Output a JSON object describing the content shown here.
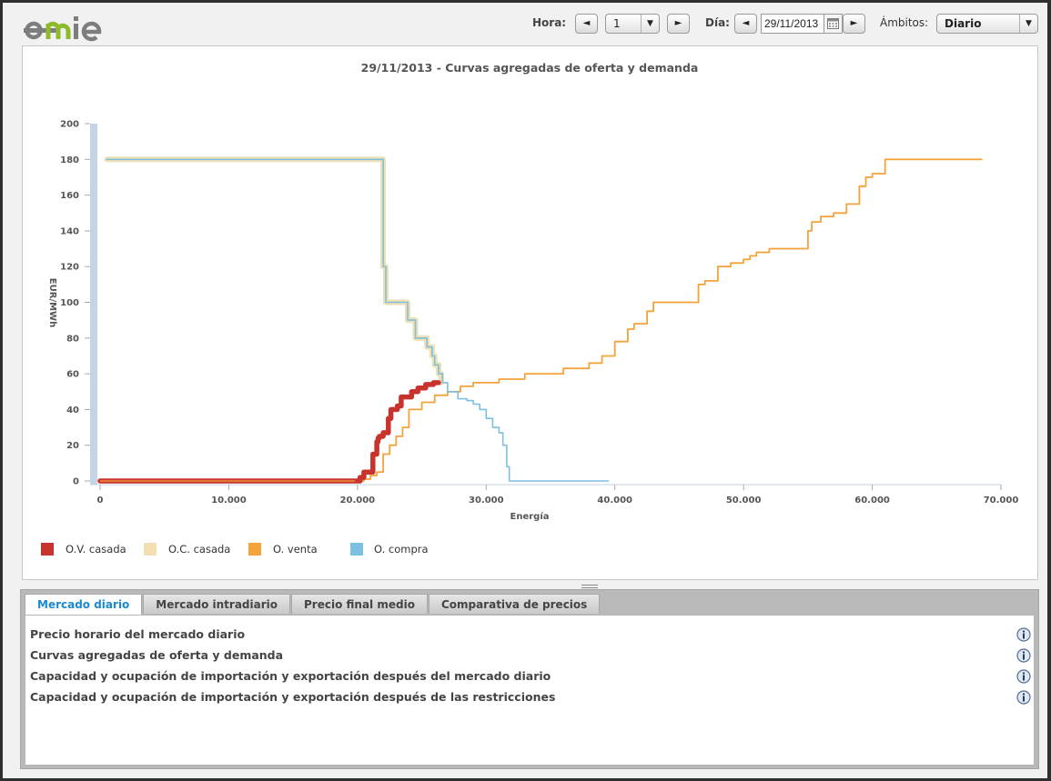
{
  "header": {
    "logo_text": "omie",
    "hora_label": "Hora:",
    "hora_value": "1",
    "dia_label": "Día:",
    "dia_value": "29/11/2013",
    "ambitos_label": "Ámbitos:",
    "ambitos_value": "Diario",
    "prev_glyph": "◄",
    "next_glyph": "►",
    "dropdown_glyph": "▼"
  },
  "colors": {
    "ov_casada": "#c8332d",
    "oc_casada": "#f3dfb4",
    "o_venta": "#f4a23a",
    "o_compra": "#7dbfe0",
    "axis_bar": "#c6d3e3",
    "active_tab": "#1a8ad0"
  },
  "chart_data": {
    "type": "line",
    "title": "29/11/2013 - Curvas agregadas de oferta y demanda",
    "xlabel": "Energía",
    "ylabel": "EUR/MWh",
    "xlim": [
      0,
      70000
    ],
    "ylim": [
      0,
      200
    ],
    "x_ticks": [
      "0",
      "10.000",
      "20.000",
      "30.000",
      "40.000",
      "50.000",
      "60.000",
      "70.000"
    ],
    "y_ticks": [
      "0",
      "20",
      "40",
      "60",
      "80",
      "100",
      "120",
      "140",
      "160",
      "180",
      "200"
    ],
    "grid": false,
    "legend_position": "bottom-left",
    "series": [
      {
        "name": "O.V. casada",
        "color": "#c8332d",
        "x": [
          0,
          19800,
          20200,
          20400,
          20500,
          20700,
          21000,
          21200,
          21500,
          21600,
          21700,
          22000,
          22400,
          22600,
          23100,
          23400,
          24200,
          24700,
          25300,
          25900,
          26300
        ],
        "y": [
          0,
          0,
          2,
          2,
          5,
          5,
          5,
          15,
          22,
          24,
          25,
          27,
          35,
          40,
          42,
          47,
          50,
          52,
          54,
          55,
          55
        ]
      },
      {
        "name": "O.C. casada",
        "color": "#f3dfb4",
        "x": [
          500,
          21800,
          22000,
          22200,
          22500,
          23700,
          23900,
          24500,
          24700,
          25400,
          25800,
          26000,
          26300,
          26500
        ],
        "y": [
          180,
          180,
          120,
          100,
          100,
          100,
          90,
          80,
          80,
          75,
          70,
          65,
          60,
          55
        ]
      },
      {
        "name": "O. venta",
        "color": "#f4a23a",
        "x": [
          0,
          20000,
          20500,
          21000,
          21500,
          22000,
          22500,
          23000,
          23500,
          24000,
          25000,
          26000,
          27000,
          28000,
          29000,
          31000,
          33000,
          36000,
          38000,
          39000,
          40000,
          41000,
          41500,
          42500,
          43000,
          46000,
          46500,
          47000,
          48000,
          49000,
          50000,
          50500,
          51000,
          52000,
          54000,
          55000,
          55300,
          56000,
          57000,
          58000,
          59000,
          59500,
          60000,
          61000,
          68500
        ],
        "y": [
          0,
          0,
          1,
          3,
          5,
          15,
          20,
          25,
          30,
          40,
          44,
          48,
          50,
          53,
          55,
          57,
          60,
          63,
          66,
          70,
          78,
          85,
          88,
          95,
          100,
          100,
          110,
          112,
          120,
          122,
          124,
          126,
          128,
          130,
          130,
          140,
          145,
          148,
          150,
          155,
          165,
          170,
          172,
          180,
          180
        ]
      },
      {
        "name": "O. compra",
        "color": "#7dbfe0",
        "x": [
          500,
          21800,
          22000,
          22200,
          22500,
          23700,
          23900,
          24500,
          24700,
          25400,
          25800,
          26000,
          26300,
          26600,
          27000,
          27800,
          28500,
          29000,
          29500,
          30000,
          30500,
          31000,
          31300,
          31600,
          31800,
          39500
        ],
        "y": [
          180,
          180,
          120,
          100,
          100,
          100,
          90,
          80,
          80,
          75,
          70,
          65,
          60,
          55,
          50,
          46,
          45,
          43,
          40,
          35,
          30,
          27,
          20,
          8,
          0,
          0
        ]
      }
    ]
  },
  "tabs": [
    "Mercado diario",
    "Mercado intradiario",
    "Precio final medio",
    "Comparativa de precios"
  ],
  "reports": [
    "Precio horario del mercado diario",
    "Curvas agregadas de oferta y demanda",
    "Capacidad y ocupación de importación y exportación después del mercado diario",
    "Capacidad y ocupación de importación y exportación después de las restricciones"
  ]
}
